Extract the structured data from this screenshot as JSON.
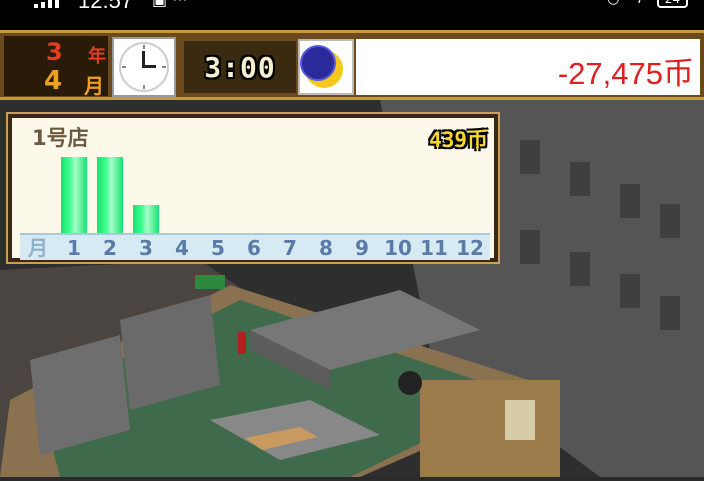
{
  "status_bar": {
    "time": "12:57",
    "battery": "24"
  },
  "top_bar": {
    "year_value": "3",
    "year_unit": "年",
    "month_value": "4",
    "month_unit": "月",
    "time": "3:00",
    "money": "-27,475币",
    "icons": [
      "analog-clock-icon",
      "crescent-moon-icon"
    ]
  },
  "sales_panel": {
    "store_name": "1号店",
    "total": "439币",
    "axis_unit": "月",
    "months": [
      "1",
      "2",
      "3",
      "4",
      "5",
      "6",
      "7",
      "8",
      "9",
      "10",
      "11",
      "12"
    ],
    "colors": {
      "bar": "#18e070",
      "panel_bg": "#fdf9ea",
      "axis_bg": "#d6eaf3"
    }
  },
  "chart_data": {
    "type": "bar",
    "title": "1号店",
    "categories": [
      "1",
      "2",
      "3",
      "4",
      "5",
      "6",
      "7",
      "8",
      "9",
      "10",
      "11",
      "12"
    ],
    "values": [
      185,
      185,
      69,
      0,
      0,
      0,
      0,
      0,
      0,
      0,
      0,
      0
    ],
    "ylim": [
      0,
      200
    ],
    "grid": false
  }
}
